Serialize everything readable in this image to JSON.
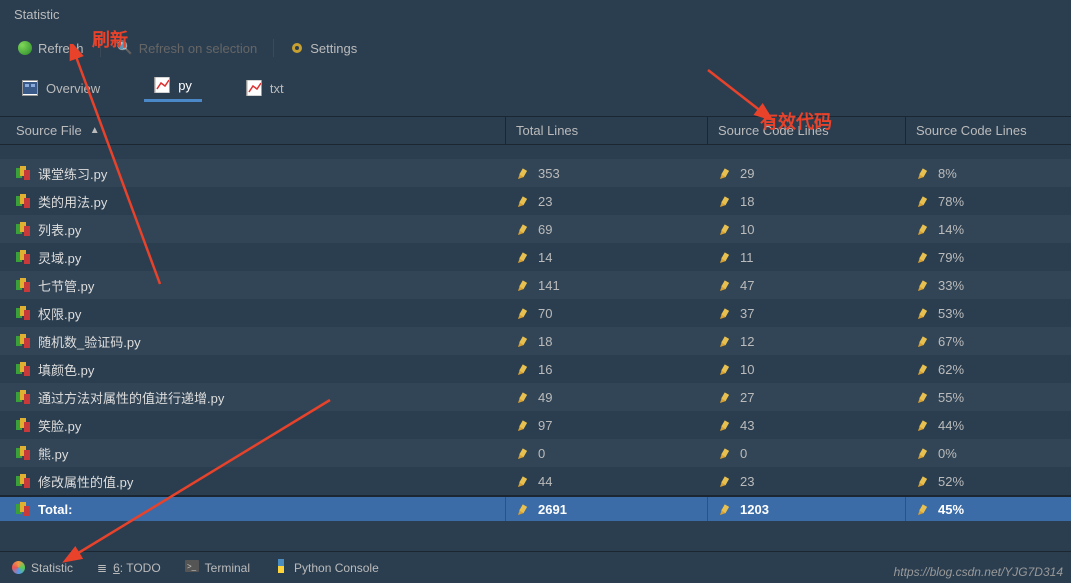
{
  "panel": {
    "title": "Statistic"
  },
  "toolbar": {
    "refresh": "Refresh",
    "refresh_selection": "Refresh on selection",
    "settings": "Settings"
  },
  "tabs": {
    "overview": "Overview",
    "py": "py",
    "txt": "txt"
  },
  "columns": {
    "source_file": "Source File",
    "total_lines": "Total Lines",
    "source_code_lines": "Source Code Lines",
    "source_code_lines2": "Source Code Lines"
  },
  "rows": [
    {
      "file": "课堂练习.py",
      "total": "353",
      "scl": "29",
      "pct": "8%"
    },
    {
      "file": "类的用法.py",
      "total": "23",
      "scl": "18",
      "pct": "78%"
    },
    {
      "file": "列表.py",
      "total": "69",
      "scl": "10",
      "pct": "14%"
    },
    {
      "file": "灵域.py",
      "total": "14",
      "scl": "11",
      "pct": "79%"
    },
    {
      "file": "七节管.py",
      "total": "141",
      "scl": "47",
      "pct": "33%"
    },
    {
      "file": "权限.py",
      "total": "70",
      "scl": "37",
      "pct": "53%"
    },
    {
      "file": "随机数_验证码.py",
      "total": "18",
      "scl": "12",
      "pct": "67%"
    },
    {
      "file": "填颜色.py",
      "total": "16",
      "scl": "10",
      "pct": "62%"
    },
    {
      "file": "通过方法对属性的值进行递增.py",
      "total": "49",
      "scl": "27",
      "pct": "55%"
    },
    {
      "file": "笑脸.py",
      "total": "97",
      "scl": "43",
      "pct": "44%"
    },
    {
      "file": "熊.py",
      "total": "0",
      "scl": "0",
      "pct": "0%"
    },
    {
      "file": "修改属性的值.py",
      "total": "44",
      "scl": "23",
      "pct": "52%"
    }
  ],
  "total": {
    "label": "Total:",
    "total": "2691",
    "scl": "1203",
    "pct": "45%"
  },
  "bottom": {
    "statistic": "Statistic",
    "todo_num": "6",
    "todo": ": TODO",
    "terminal": "Terminal",
    "python": "Python Console"
  },
  "annotations": {
    "refresh": "刷新",
    "valid_code": "有效代码"
  },
  "watermark": "https://blog.csdn.net/YJG7D314"
}
